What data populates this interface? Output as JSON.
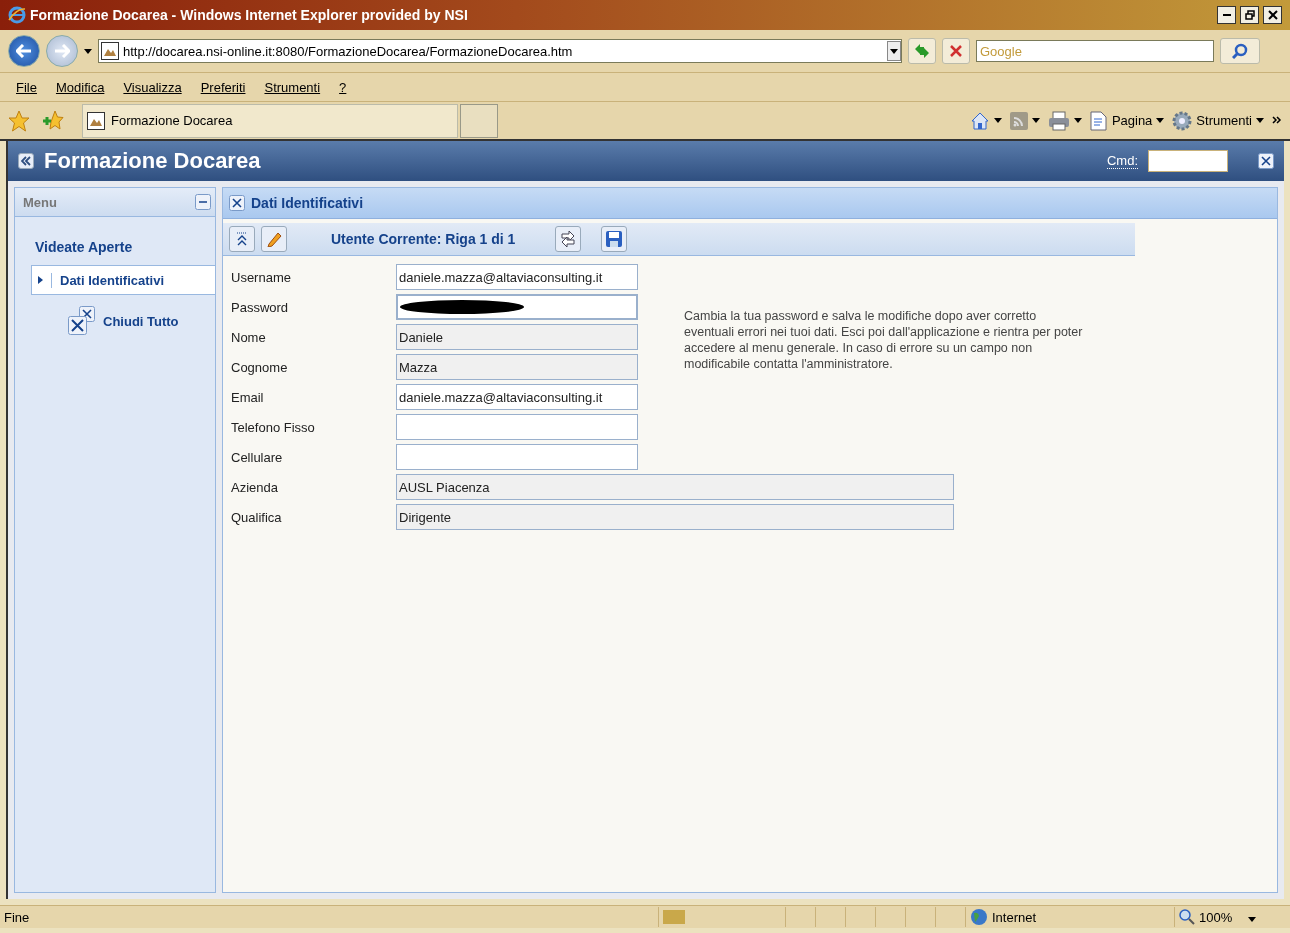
{
  "window": {
    "title": "Formazione Docarea - Windows Internet Explorer provided by NSI"
  },
  "address_bar": {
    "url": "http://docarea.nsi-online.it:8080/FormazioneDocarea/FormazioneDocarea.htm"
  },
  "search": {
    "placeholder": "Google"
  },
  "menu_bar": [
    "File",
    "Modifica",
    "Visualizza",
    "Preferiti",
    "Strumenti",
    "?"
  ],
  "browser_tab": {
    "label": "Formazione Docarea"
  },
  "command_bar": [
    {
      "kind": "home"
    },
    {
      "kind": "feed"
    },
    {
      "kind": "print"
    },
    {
      "kind": "page",
      "label": "Pagina"
    },
    {
      "kind": "tools",
      "label": "Strumenti"
    }
  ],
  "app": {
    "title": "Formazione Docarea",
    "cmd_label": "Cmd:"
  },
  "sidebar": {
    "title": "Menu",
    "section": "Videate Aperte",
    "items": [
      {
        "label": "Dati Identificativi",
        "selected": true
      }
    ],
    "close_all": "Chiudi Tutto"
  },
  "panel": {
    "title": "Dati Identificativi",
    "record_label": "Utente Corrente: Riga 1 di 1",
    "fields": [
      {
        "label": "Username",
        "kind": "editable",
        "value": "daniele.mazza@altaviaconsulting.it"
      },
      {
        "label": "Password",
        "kind": "password"
      },
      {
        "label": "Nome",
        "kind": "readonly",
        "value": "Daniele"
      },
      {
        "label": "Cognome",
        "kind": "readonly",
        "value": "Mazza"
      },
      {
        "label": "Email",
        "kind": "editable",
        "value": "daniele.mazza@altaviaconsulting.it"
      },
      {
        "label": "Telefono Fisso",
        "kind": "editable"
      },
      {
        "label": "Cellulare",
        "kind": "editable"
      },
      {
        "label": "Azienda",
        "kind": "readonly-wide",
        "value": "AUSL Piacenza"
      },
      {
        "label": "Qualifica",
        "kind": "readonly-wide",
        "value": "Dirigente"
      }
    ],
    "note": "Cambia la tua password e salva le modifiche dopo aver corretto eventuali errori nei tuoi dati. Esci poi dall'applicazione e rientra per poter accedere al menu generale. In caso di errore su un campo non modificabile contatta l'amministratore."
  },
  "status_bar": {
    "text": "Fine",
    "zone": "Internet",
    "zoom": "100%"
  }
}
